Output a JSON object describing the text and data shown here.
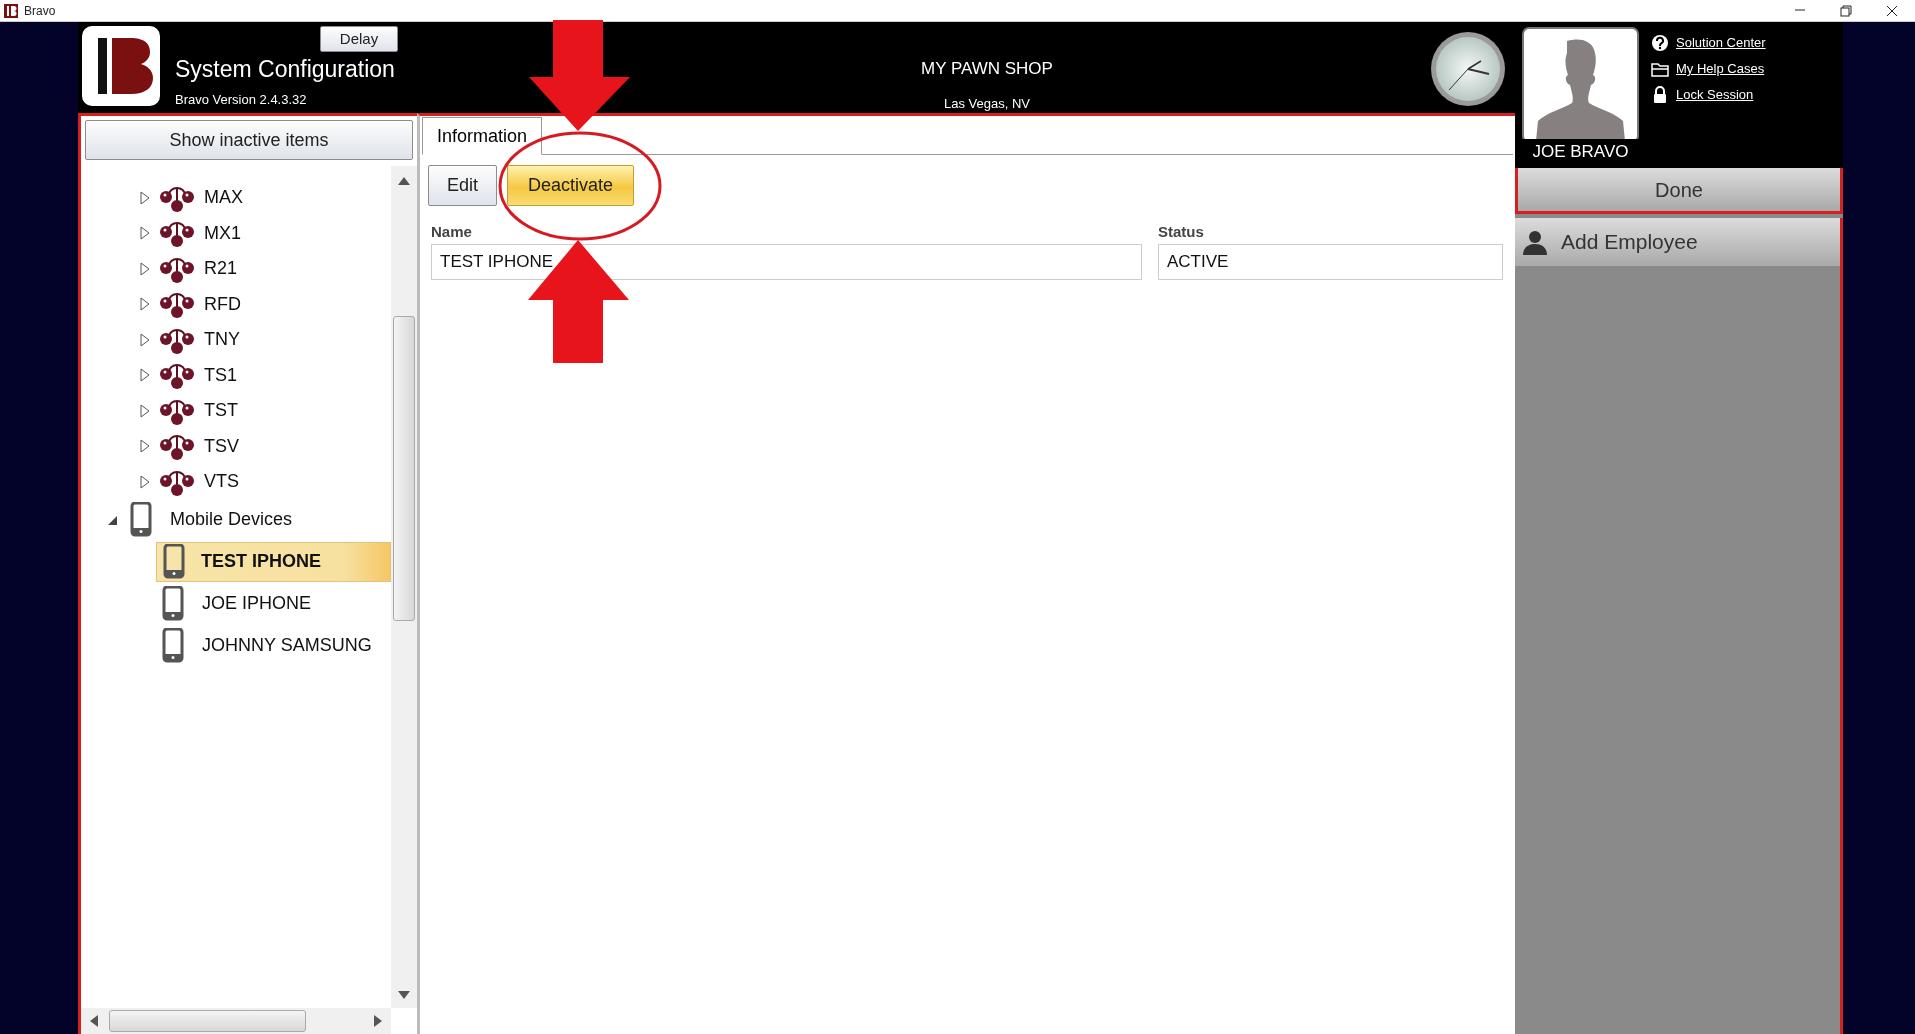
{
  "window": {
    "title": "Bravo"
  },
  "header": {
    "delay_button": "Delay",
    "title": "System Configuration",
    "version": "Bravo Version 2.4.3.32",
    "store_name": "MY PAWN SHOP",
    "store_location": "Las Vegas, NV"
  },
  "user": {
    "name": "JOE BRAVO",
    "links": [
      {
        "kind": "help",
        "label": "Solution Center"
      },
      {
        "kind": "folder",
        "label": "My Help Cases"
      },
      {
        "kind": "lock",
        "label": "Lock Session"
      }
    ]
  },
  "sidebar": {
    "toggle_button": "Show inactive items",
    "tree": [
      {
        "kind": "store",
        "label": "MAX",
        "expanded": false,
        "selected": false
      },
      {
        "kind": "store",
        "label": "MX1",
        "expanded": false,
        "selected": false
      },
      {
        "kind": "store",
        "label": "R21",
        "expanded": false,
        "selected": false
      },
      {
        "kind": "store",
        "label": "RFD",
        "expanded": false,
        "selected": false
      },
      {
        "kind": "store",
        "label": "TNY",
        "expanded": false,
        "selected": false
      },
      {
        "kind": "store",
        "label": "TS1",
        "expanded": false,
        "selected": false
      },
      {
        "kind": "store",
        "label": "TST",
        "expanded": false,
        "selected": false
      },
      {
        "kind": "store",
        "label": "TSV",
        "expanded": false,
        "selected": false
      },
      {
        "kind": "store",
        "label": "VTS",
        "expanded": false,
        "selected": false
      },
      {
        "kind": "group",
        "label": "Mobile Devices",
        "expanded": true,
        "selected": false,
        "children": [
          {
            "kind": "device",
            "label": "TEST IPHONE",
            "selected": true
          },
          {
            "kind": "device",
            "label": "JOE IPHONE",
            "selected": false
          },
          {
            "kind": "device",
            "label": "JOHNNY SAMSUNG",
            "selected": false
          }
        ]
      }
    ]
  },
  "tabs": [
    {
      "label": "Information",
      "selected": true
    }
  ],
  "toolbar": [
    {
      "kind": "normal",
      "label": "Edit"
    },
    {
      "kind": "highlighted",
      "label": "Deactivate"
    }
  ],
  "fields": [
    {
      "label": "Name",
      "value": "TEST IPHONE"
    },
    {
      "label": "Status",
      "value": "ACTIVE"
    }
  ],
  "right_panel": {
    "done_button": "Done",
    "actions": [
      {
        "label": "Add Employee"
      }
    ]
  }
}
